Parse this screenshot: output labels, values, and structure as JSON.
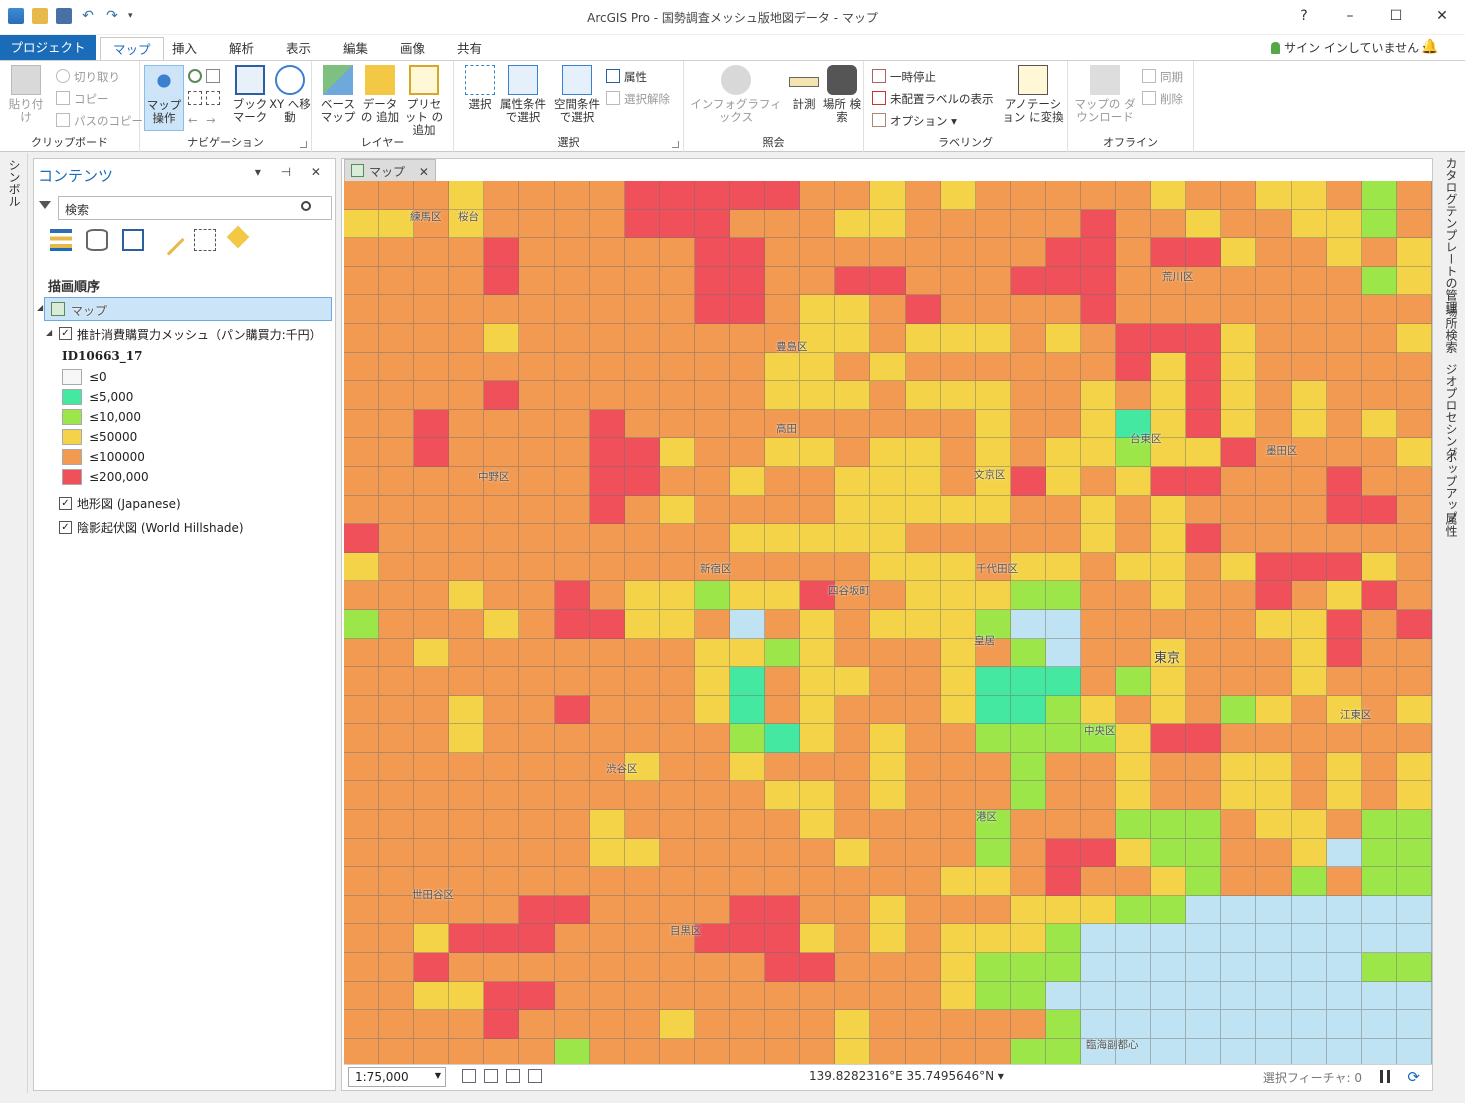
{
  "window": {
    "title": "ArcGIS Pro - 国勢調査メッシュ版地図データ - マップ",
    "help": "?",
    "minimize": "–",
    "maximize": "☐",
    "close": "✕"
  },
  "quick_access": {
    "undo": "↶",
    "redo": "↷",
    "more": "▾"
  },
  "tabs": {
    "project": "プロジェクト",
    "items": [
      "マップ",
      "挿入",
      "解析",
      "表示",
      "編集",
      "画像",
      "共有"
    ]
  },
  "account": {
    "signin": "サイン インしていません ▾"
  },
  "ribbon": {
    "clipboard": {
      "label": "クリップボード",
      "paste": "貼り付け",
      "cut": "切り取り",
      "copy": "コピー",
      "copy_path": "パスのコピー"
    },
    "navigation": {
      "label": "ナビゲーション",
      "explore": "マップ 操作",
      "bookmarks": "ブック マーク",
      "goto_xy": "XY へ移動"
    },
    "layer": {
      "label": "レイヤー",
      "basemap": "ベース マップ",
      "add_data": "データの 追加",
      "add_preset": "プリセット の追加"
    },
    "selection": {
      "label": "選択",
      "select": "選択",
      "select_by_attr": "属性条件 で選択",
      "select_by_loc": "空間条件 で選択",
      "attributes": "属性",
      "clear": "選択解除"
    },
    "inquiry": {
      "label": "照会",
      "infographics": "インフォグラフィックス",
      "measure": "計測",
      "locate": "場所 検索"
    },
    "labeling": {
      "label": "ラベリング",
      "pause": "一時停止",
      "unplaced": "未配置ラベルの表示",
      "options": "オプション ▾",
      "convert": "アノテーション に変換"
    },
    "offline": {
      "label": "オフライン",
      "download": "マップの ダウンロード",
      "sync": "同期",
      "remove": "削除"
    }
  },
  "left_strip": {
    "symbol": "シンボル"
  },
  "right_strip": [
    "カタログ",
    "テンプレートの管理",
    "場所検索",
    "ジオプロセシング",
    "ポップアップ",
    "属性"
  ],
  "contents": {
    "title": "コンテンツ",
    "controls": "▾ ⊣ ✕",
    "search_placeholder": "検索",
    "draw_order": "描画順序",
    "map_name": "マップ",
    "layer_name": "推計消費購買力メッシュ（パン購買力:千円）",
    "field_name": "ID10663_17",
    "legend": [
      {
        "label": "≤0",
        "color": "#f7f7f7"
      },
      {
        "label": "≤5,000",
        "color": "#44e8a0"
      },
      {
        "label": "≤10,000",
        "color": "#9de64a"
      },
      {
        "label": "≤50000",
        "color": "#f5d348"
      },
      {
        "label": "≤100000",
        "color": "#f29a52"
      },
      {
        "label": "≤200,000",
        "color": "#f0505a"
      }
    ],
    "basemaps": [
      "地形図 (Japanese)",
      "陰影起伏図 (World Hillshade)"
    ]
  },
  "map_view": {
    "tab": "マップ",
    "close": "✕",
    "labels": [
      {
        "text": "練馬区"
      },
      {
        "text": "荒川区"
      },
      {
        "text": "豊島区"
      },
      {
        "text": "台東区"
      },
      {
        "text": "墨田区"
      },
      {
        "text": "中野区"
      },
      {
        "text": "文京区"
      },
      {
        "text": "新宿区"
      },
      {
        "text": "千代田区"
      },
      {
        "text": "四谷坂町"
      },
      {
        "text": "東京"
      },
      {
        "text": "中央区"
      },
      {
        "text": "江東区"
      },
      {
        "text": "渋谷区"
      },
      {
        "text": "港区"
      },
      {
        "text": "世田谷区"
      },
      {
        "text": "目黒区"
      },
      {
        "text": "高田"
      },
      {
        "text": "皇居"
      },
      {
        "text": "臨海副都心"
      },
      {
        "text": "桜台"
      }
    ]
  },
  "status": {
    "scale": "1:75,000",
    "coordinates": "139.8282316°E 35.7495646°N ▾",
    "selected_features": "選択フィーチャ: 0",
    "refresh": "⟳"
  }
}
